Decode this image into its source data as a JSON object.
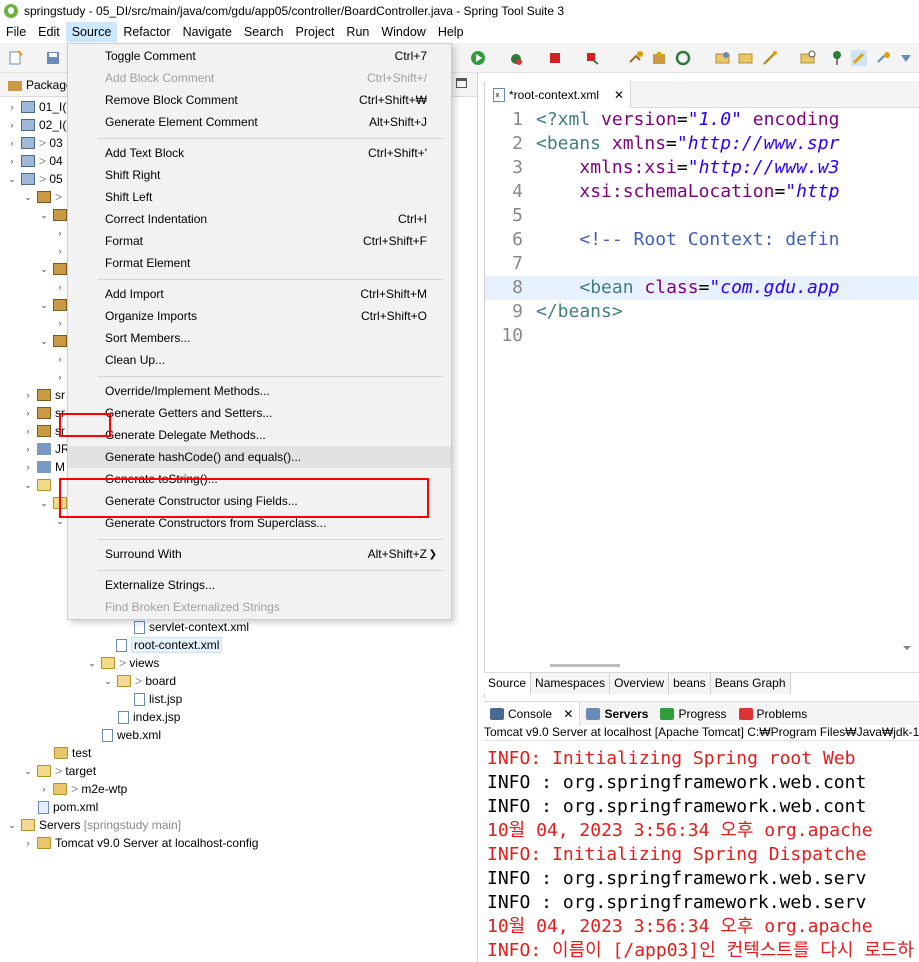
{
  "title": "springstudy - 05_DI/src/main/java/com/gdu/app05/controller/BoardController.java - Spring Tool Suite 3",
  "menubar": [
    "File",
    "Edit",
    "Source",
    "Refactor",
    "Navigate",
    "Search",
    "Project",
    "Run",
    "Window",
    "Help"
  ],
  "package_explorer": {
    "tab_label": "Package",
    "rows": {
      "r01": "01_I(",
      "r02": "02_I(",
      "r03": "03",
      "r04": "04",
      "r05": "05",
      "src_trunc": "sr",
      "src_trunc2": "sr",
      "src_trunc3": "sr",
      "jre_trunc": "JR",
      "maven_trunc": "M",
      "servlet_context": "servlet-context.xml",
      "root_context": "root-context.xml",
      "views": "views",
      "board": "board",
      "list_jsp": "list.jsp",
      "index_jsp": "index.jsp",
      "web_xml": "web.xml",
      "test": "test",
      "target": "target",
      "m2e_wtp": "m2e-wtp",
      "pom_xml": "pom.xml",
      "servers": "Servers",
      "servers_sub": "[springstudy main]",
      "tomcat": "Tomcat v9.0 Server at localhost-config"
    }
  },
  "context_menu": {
    "toggle_comment": {
      "label": "Toggle Comment",
      "shortcut": "Ctrl+7"
    },
    "add_block_comment": {
      "label": "Add Block Comment",
      "shortcut": "Ctrl+Shift+/"
    },
    "remove_block_comment": {
      "label": "Remove Block Comment",
      "shortcut": "Ctrl+Shift+₩"
    },
    "generate_element_comment": {
      "label": "Generate Element Comment",
      "shortcut": "Alt+Shift+J"
    },
    "add_text_block": {
      "label": "Add Text Block",
      "shortcut": "Ctrl+Shift+'"
    },
    "shift_right": {
      "label": "Shift Right",
      "shortcut": ""
    },
    "shift_left": {
      "label": "Shift Left",
      "shortcut": ""
    },
    "correct_indentation": {
      "label": "Correct Indentation",
      "shortcut": "Ctrl+I"
    },
    "format": {
      "label": "Format",
      "shortcut": "Ctrl+Shift+F"
    },
    "format_element": {
      "label": "Format Element",
      "shortcut": ""
    },
    "add_import": {
      "label": "Add Import",
      "shortcut": "Ctrl+Shift+M"
    },
    "organize_imports": {
      "label": "Organize Imports",
      "shortcut": "Ctrl+Shift+O"
    },
    "sort_members": {
      "label": "Sort Members...",
      "shortcut": ""
    },
    "clean_up": {
      "label": "Clean Up...",
      "shortcut": ""
    },
    "override_implement": {
      "label": "Override/Implement Methods...",
      "shortcut": ""
    },
    "generate_getters_setters": {
      "label": "Generate Getters and Setters...",
      "shortcut": ""
    },
    "generate_delegate": {
      "label": "Generate Delegate Methods...",
      "shortcut": ""
    },
    "generate_hashcode": {
      "label": "Generate hashCode() and equals()...",
      "shortcut": ""
    },
    "generate_tostring": {
      "label": "Generate toString()...",
      "shortcut": ""
    },
    "generate_constructor_fields": {
      "label": "Generate Constructor using Fields...",
      "shortcut": ""
    },
    "generate_constructors_super": {
      "label": "Generate Constructors from Superclass...",
      "shortcut": ""
    },
    "surround_with": {
      "label": "Surround With",
      "shortcut": "Alt+Shift+Z"
    },
    "externalize_strings": {
      "label": "Externalize Strings...",
      "shortcut": ""
    },
    "find_broken_strings": {
      "label": "Find Broken Externalized Strings",
      "shortcut": ""
    }
  },
  "editor": {
    "tab_label": "*root-context.xml",
    "lines": [
      {
        "n": "1",
        "parts": [
          [
            "c-tag",
            "<?xml "
          ],
          [
            "c-attr",
            "version"
          ],
          [
            "",
            "="
          ],
          [
            "c-str",
            "\"1.0\""
          ],
          [
            "c-attr",
            " encoding"
          ]
        ]
      },
      {
        "n": "2",
        "parts": [
          [
            "c-tag",
            "<beans "
          ],
          [
            "c-attr",
            "xmlns"
          ],
          [
            "",
            "="
          ],
          [
            "c-str",
            "\"http://www.spr"
          ]
        ]
      },
      {
        "n": "3",
        "parts": [
          [
            "",
            "    "
          ],
          [
            "c-attr",
            "xmlns:xsi"
          ],
          [
            "",
            "="
          ],
          [
            "c-str",
            "\"http://www.w3"
          ]
        ]
      },
      {
        "n": "4",
        "parts": [
          [
            "",
            "    "
          ],
          [
            "c-attr",
            "xsi:schemaLocation"
          ],
          [
            "",
            "="
          ],
          [
            "c-str",
            "\"http"
          ]
        ]
      },
      {
        "n": "5",
        "parts": [
          [
            "",
            ""
          ]
        ]
      },
      {
        "n": "6",
        "parts": [
          [
            "",
            "    "
          ],
          [
            "c-cmt",
            "<!-- Root Context: defin"
          ]
        ]
      },
      {
        "n": "7",
        "parts": [
          [
            "",
            ""
          ]
        ]
      },
      {
        "n": "8",
        "parts": [
          [
            "",
            "    "
          ],
          [
            "c-tag",
            "<bean "
          ],
          [
            "c-attr",
            "class"
          ],
          [
            "",
            "="
          ],
          [
            "c-str",
            "\"com.gdu.app"
          ]
        ]
      },
      {
        "n": "9",
        "parts": [
          [
            "c-tag",
            "</beans>"
          ]
        ]
      },
      {
        "n": "10",
        "parts": [
          [
            "",
            ""
          ]
        ]
      }
    ],
    "subtabs": [
      "Source",
      "Namespaces",
      "Overview",
      "beans",
      "Beans Graph"
    ]
  },
  "console": {
    "tabs": [
      "Console",
      "Servers",
      "Progress",
      "Problems"
    ],
    "description": "Tomcat v9.0 Server at localhost [Apache Tomcat] C:₩Program Files₩Java₩jdk-11",
    "lines": [
      {
        "color": "con-red",
        "text": "INFO: Initializing Spring root Web"
      },
      {
        "color": "con-black",
        "text": "INFO : org.springframework.web.cont"
      },
      {
        "color": "con-black",
        "text": "INFO : org.springframework.web.cont"
      },
      {
        "color": "con-red",
        "text": "10월 04, 2023 3:56:34 오후 org.apache"
      },
      {
        "color": "con-red",
        "text": "INFO: Initializing Spring Dispatche"
      },
      {
        "color": "con-black",
        "text": "INFO : org.springframework.web.serv"
      },
      {
        "color": "con-black",
        "text": "INFO : org.springframework.web.serv"
      },
      {
        "color": "con-red",
        "text": "10월 04, 2023 3:56:34 오후 org.apache"
      },
      {
        "color": "con-red",
        "text": "INFO: 이름이 [/app03]인 컨텍스트를 다시 로드하"
      }
    ]
  }
}
